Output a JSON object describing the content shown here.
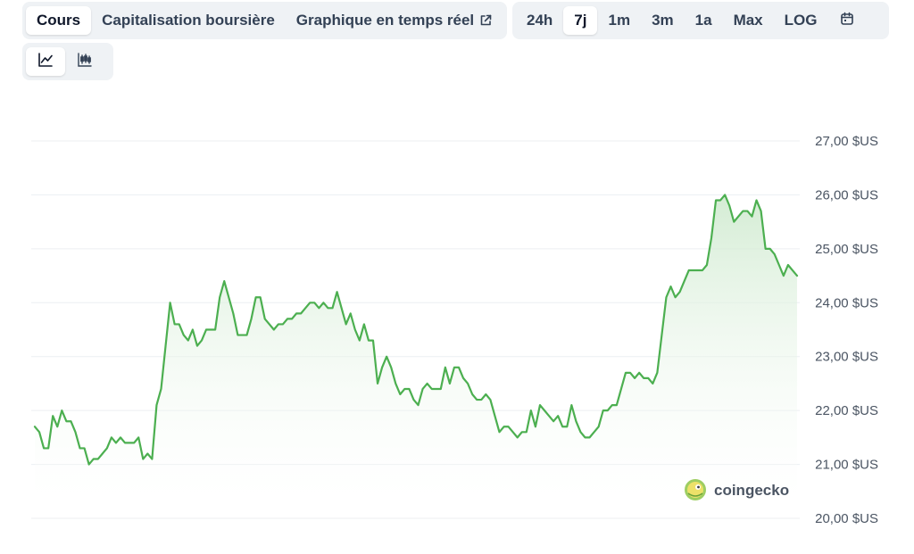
{
  "toolbar": {
    "metric_tabs": [
      {
        "label": "Cours",
        "active": true
      },
      {
        "label": "Capitalisation boursière",
        "active": false
      },
      {
        "label": "Graphique en temps réel",
        "active": false,
        "icon": "external-link-icon"
      }
    ],
    "range_tabs": [
      {
        "label": "24h",
        "active": false
      },
      {
        "label": "7j",
        "active": true
      },
      {
        "label": "1m",
        "active": false
      },
      {
        "label": "3m",
        "active": false
      },
      {
        "label": "1a",
        "active": false
      },
      {
        "label": "Max",
        "active": false
      },
      {
        "label": "LOG",
        "active": false
      }
    ],
    "calendar_icon": "calendar-icon",
    "chart_type_buttons": [
      {
        "icon": "line-chart-icon",
        "active": true
      },
      {
        "icon": "candlestick-chart-icon",
        "active": false
      }
    ]
  },
  "watermark": {
    "text": "coingecko",
    "icon": "gecko-logo-icon"
  },
  "colors": {
    "line": "#4caf50",
    "fill_top": "#cfeacf",
    "grid": "#eceff2"
  },
  "chart_data": {
    "type": "area",
    "title": "",
    "xlabel": "",
    "ylabel": "",
    "y_ticks": [
      "27,00 $US",
      "26,00 $US",
      "25,00 $US",
      "24,00 $US",
      "23,00 $US",
      "22,00 $US",
      "21,00 $US",
      "20,00 $US"
    ],
    "ylim": [
      20,
      27
    ],
    "grid": true,
    "x_axis_labels_shown": false,
    "values": [
      21.7,
      21.6,
      21.3,
      21.3,
      21.9,
      21.7,
      22.0,
      21.8,
      21.8,
      21.6,
      21.3,
      21.3,
      21.0,
      21.1,
      21.1,
      21.2,
      21.3,
      21.5,
      21.4,
      21.5,
      21.4,
      21.4,
      21.4,
      21.5,
      21.1,
      21.2,
      21.1,
      22.1,
      22.4,
      23.2,
      24.0,
      23.6,
      23.6,
      23.4,
      23.3,
      23.5,
      23.2,
      23.3,
      23.5,
      23.5,
      23.5,
      24.1,
      24.4,
      24.1,
      23.8,
      23.4,
      23.4,
      23.4,
      23.7,
      24.1,
      24.1,
      23.7,
      23.6,
      23.5,
      23.6,
      23.6,
      23.7,
      23.7,
      23.8,
      23.8,
      23.9,
      24.0,
      24.0,
      23.9,
      24.0,
      23.9,
      23.9,
      24.2,
      23.9,
      23.6,
      23.8,
      23.5,
      23.3,
      23.6,
      23.3,
      23.3,
      22.5,
      22.8,
      23.0,
      22.8,
      22.5,
      22.3,
      22.4,
      22.4,
      22.2,
      22.1,
      22.4,
      22.5,
      22.4,
      22.4,
      22.4,
      22.8,
      22.5,
      22.8,
      22.8,
      22.6,
      22.5,
      22.3,
      22.2,
      22.2,
      22.3,
      22.2,
      21.9,
      21.6,
      21.7,
      21.7,
      21.6,
      21.5,
      21.6,
      21.6,
      22.0,
      21.7,
      22.1,
      22.0,
      21.9,
      21.8,
      21.9,
      21.7,
      21.7,
      22.1,
      21.8,
      21.6,
      21.5,
      21.5,
      21.6,
      21.7,
      22.0,
      22.0,
      22.1,
      22.1,
      22.4,
      22.7,
      22.7,
      22.6,
      22.7,
      22.6,
      22.6,
      22.5,
      22.7,
      23.4,
      24.1,
      24.3,
      24.1,
      24.2,
      24.4,
      24.6,
      24.6,
      24.6,
      24.6,
      24.7,
      25.2,
      25.9,
      25.9,
      26.0,
      25.8,
      25.5,
      25.6,
      25.7,
      25.7,
      25.6,
      25.9,
      25.7,
      25.0,
      25.0,
      24.9,
      24.7,
      24.5,
      24.7,
      24.6,
      24.5
    ]
  }
}
